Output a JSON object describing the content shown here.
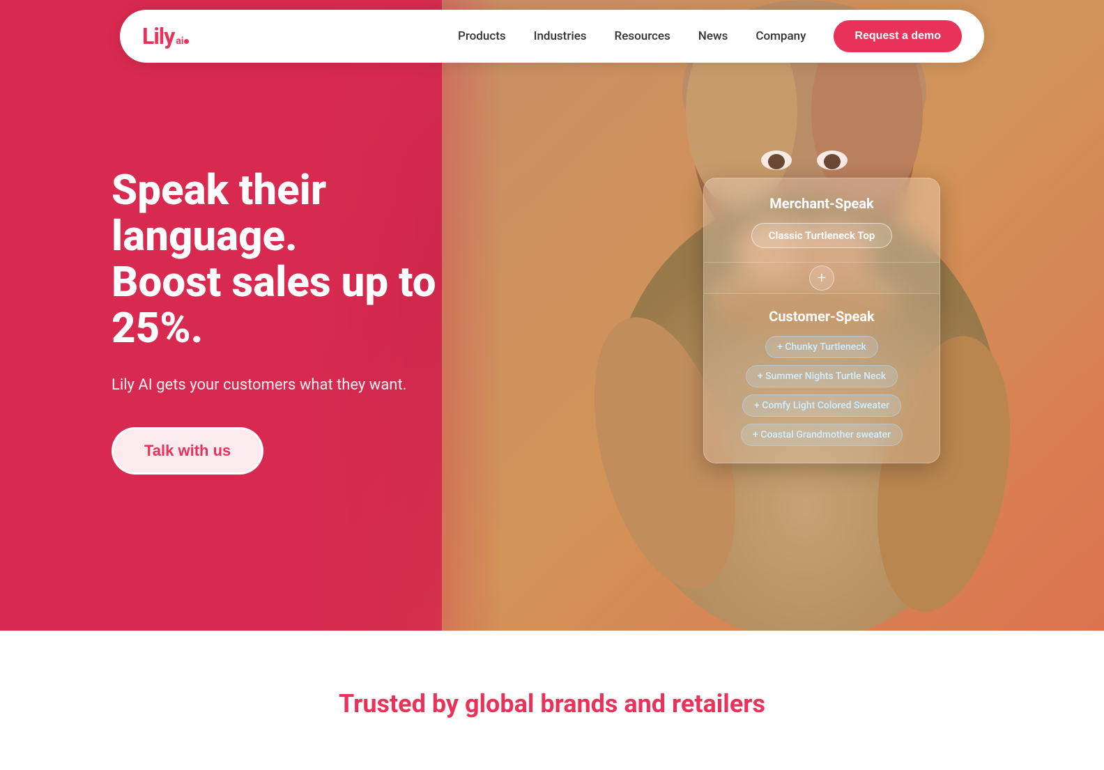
{
  "nav": {
    "logo_text": "Lily",
    "logo_sup": "ai",
    "links": [
      {
        "label": "Products",
        "id": "products"
      },
      {
        "label": "Industries",
        "id": "industries"
      },
      {
        "label": "Resources",
        "id": "resources"
      },
      {
        "label": "News",
        "id": "news"
      },
      {
        "label": "Company",
        "id": "company"
      }
    ],
    "cta_label": "Request a demo"
  },
  "hero": {
    "headline_line1": "Speak their language.",
    "headline_line2": "Boost sales up to 25%.",
    "subtext": "Lily AI gets your customers what they want.",
    "cta_label": "Talk with us"
  },
  "speak_card": {
    "merchant_title": "Merchant-Speak",
    "merchant_tag": "Classic Turtleneck Top",
    "divider_icon": "+",
    "customer_title": "Customer-Speak",
    "customer_tags": [
      "+ Chunky Turtleneck",
      "+ Summer Nights Turtle Neck",
      "+ Comfy Light Colored Sweater",
      "+ Coastal Grandmother sweater"
    ]
  },
  "trusted": {
    "title": "Trusted by global brands and retailers"
  }
}
